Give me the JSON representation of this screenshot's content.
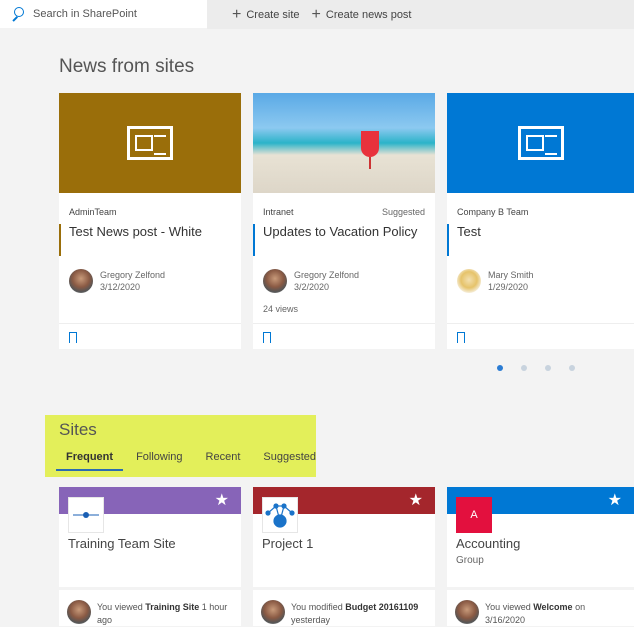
{
  "search": {
    "placeholder": "Search in SharePoint",
    "icon": "search-icon"
  },
  "toolbar": {
    "create_site": "Create site",
    "create_news": "Create news post"
  },
  "news": {
    "title": "News from sites",
    "cards": [
      {
        "site": "AdminTeam",
        "suggested": "",
        "title": "Test News post - White",
        "author": "Gregory Zelfond",
        "date": "3/12/2020",
        "views": "",
        "color": "#9a6e0a"
      },
      {
        "site": "Intranet",
        "suggested": "Suggested",
        "title": "Updates to Vacation Policy",
        "author": "Gregory Zelfond",
        "date": "3/2/2020",
        "views": "24 views",
        "color": "#0078d4"
      },
      {
        "site": "Company B Team",
        "suggested": "",
        "title": "Test",
        "author": "Mary Smith",
        "date": "1/29/2020",
        "views": "",
        "color": "#0078d4"
      }
    ],
    "pager": {
      "pages": 4,
      "current": 1
    }
  },
  "sites": {
    "title": "Sites",
    "tabs": [
      "Frequent",
      "Following",
      "Recent",
      "Suggested"
    ],
    "active_tab": "Frequent",
    "cards": [
      {
        "name": "Training Team Site",
        "sub": "",
        "band": "#8764b8",
        "logo_letter": "",
        "activity_pre": "You viewed ",
        "activity_bold": "Training Site",
        "activity_post": " 1 hour ago"
      },
      {
        "name": "Project 1",
        "sub": "",
        "band": "#a4262c",
        "logo_letter": "",
        "activity_pre": "You modified ",
        "activity_bold": "Budget 20161109",
        "activity_post": " yesterday"
      },
      {
        "name": "Accounting",
        "sub": "Group",
        "band": "#0078d4",
        "logo_letter": "A",
        "activity_pre": "You viewed ",
        "activity_bold": "Welcome",
        "activity_post": " on 3/16/2020"
      }
    ]
  },
  "colors": {
    "accent": "#0078d4",
    "highlight": "#e3ef5a"
  }
}
